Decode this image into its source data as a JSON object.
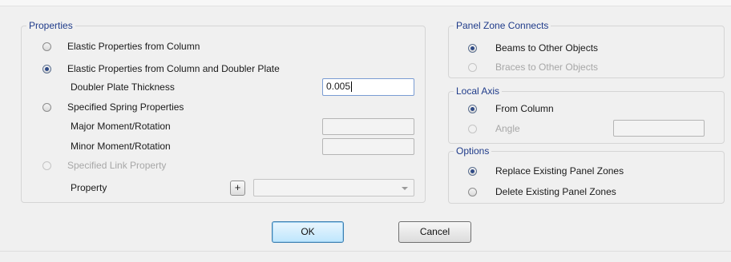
{
  "properties": {
    "legend": "Properties",
    "options": {
      "elastic_column": "Elastic Properties from Column",
      "elastic_doubler": "Elastic Properties from Column and Doubler Plate",
      "spring": "Specified Spring Properties",
      "link": "Specified Link Property"
    },
    "selected_option": "elastic_doubler",
    "doubler_thickness_label": "Doubler Plate Thickness",
    "doubler_thickness_value": "0.005",
    "major_moment_label": "Major Moment/Rotation",
    "major_moment_value": "",
    "minor_moment_label": "Minor Moment/Rotation",
    "minor_moment_value": "",
    "property_label": "Property",
    "plus_label": "+",
    "property_value": ""
  },
  "panel_zone_connects": {
    "legend": "Panel Zone Connects",
    "beams_label": "Beams to Other Objects",
    "braces_label": "Braces to Other Objects",
    "selected": "beams"
  },
  "local_axis": {
    "legend": "Local Axis",
    "from_column_label": "From Column",
    "angle_label": "Angle",
    "angle_value": "",
    "selected": "from_column"
  },
  "options": {
    "legend": "Options",
    "replace_label": "Replace Existing Panel Zones",
    "delete_label": "Delete Existing Panel Zones",
    "selected": "replace"
  },
  "buttons": {
    "ok_label": "OK",
    "cancel_label": "Cancel"
  }
}
